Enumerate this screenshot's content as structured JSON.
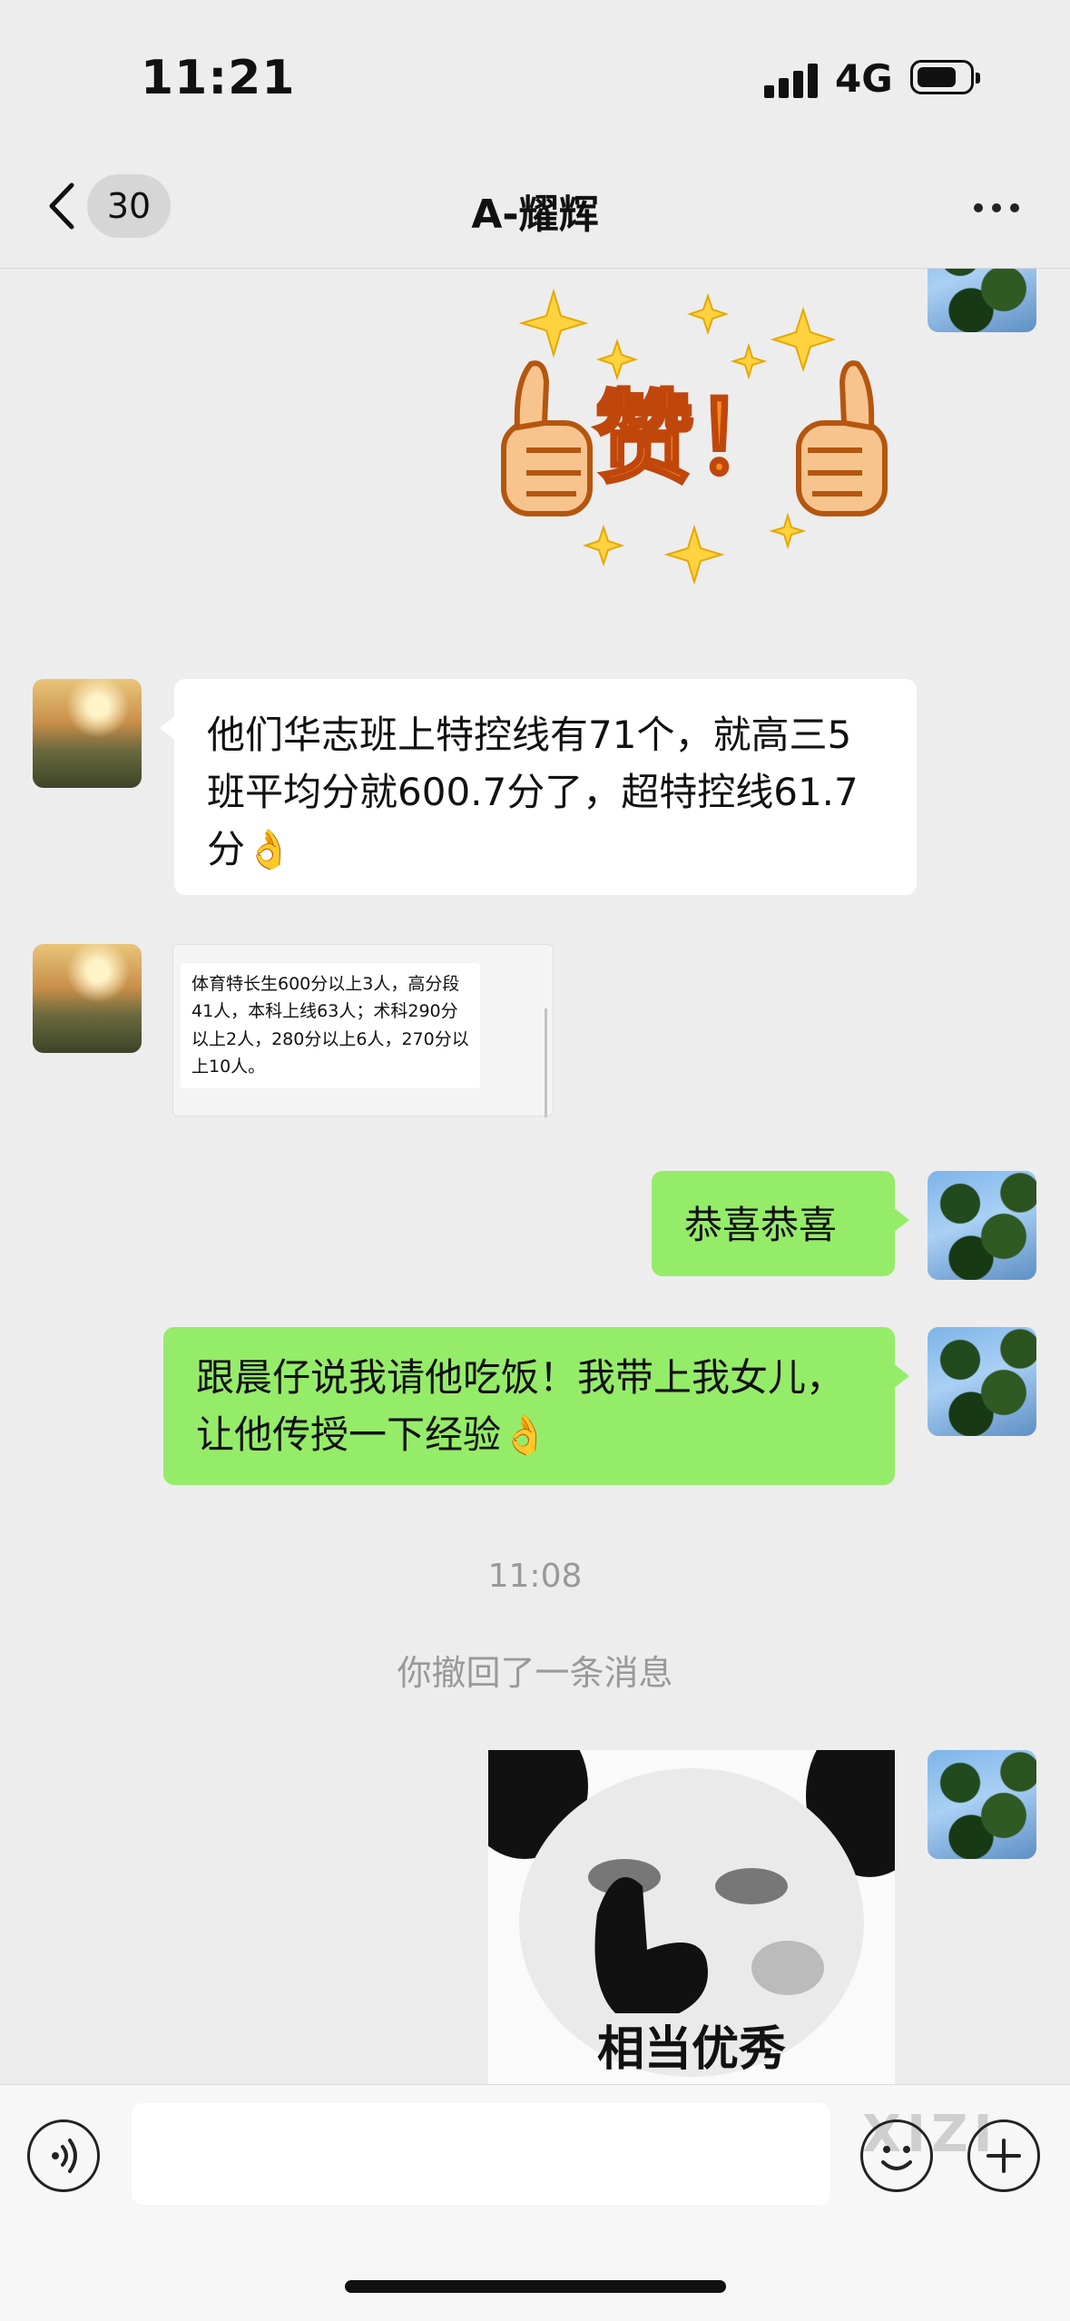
{
  "status_bar": {
    "time": "11:21",
    "network": "4G"
  },
  "nav": {
    "unread_count": "30",
    "title": "A-耀辉"
  },
  "messages": [
    {
      "text": "他们华志班上特控线有71个，就高三5班平均分就600.7分了，超特控线61.7分👌"
    },
    {
      "quote_text": "体育特长生600分以上3人，高分段41人，本科上线63人；术科290分以上2人，280分以上6人，270分以上10人。"
    },
    {
      "text": "恭喜恭喜"
    },
    {
      "text": "跟晨仔说我请他吃饭！我带上我女儿，让他传授一下经验👌"
    }
  ],
  "timestamp": "11:08",
  "system_note": "你撤回了一条消息",
  "sticker_zan_text": "赞！",
  "meme_caption": "相当优秀",
  "watermark": "XIZI"
}
